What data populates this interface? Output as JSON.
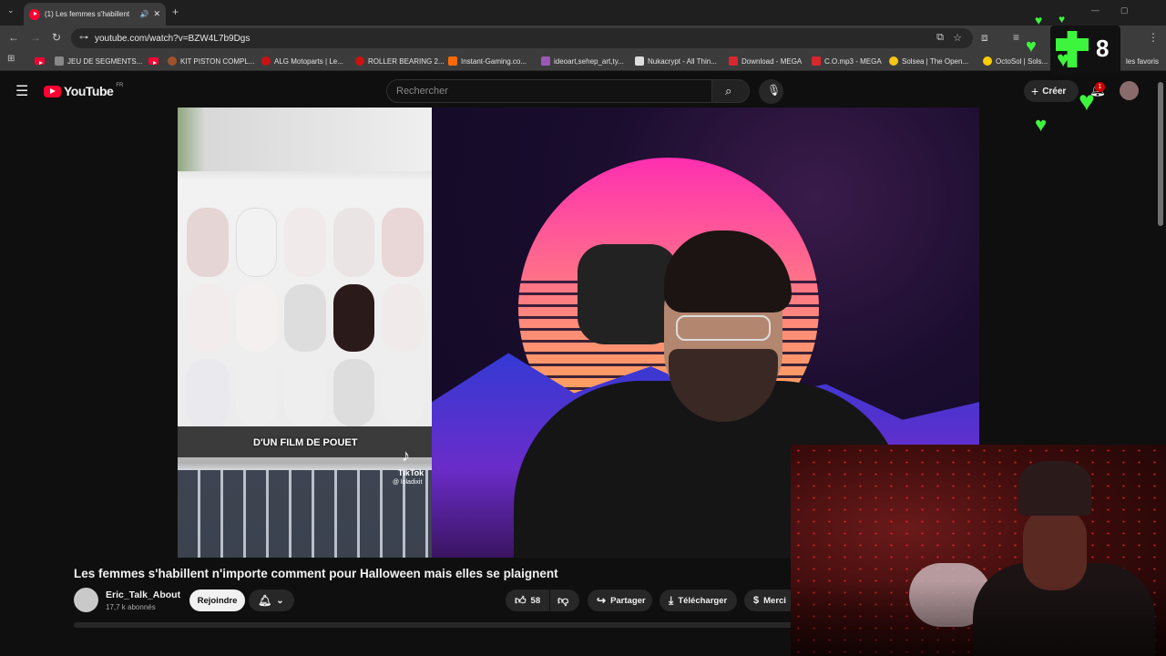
{
  "browser": {
    "tab_title": "(1) Les femmes s'habillent",
    "url": "youtube.com/watch?v=BZW4L7b9Dgs",
    "bookmarks": [
      {
        "label": "JEU DE SEGMENTS...",
        "color": "#888888"
      },
      {
        "label": "KIT PISTON COMPL...",
        "color": "#a0522d"
      },
      {
        "label": "ALG Motoparts | Le...",
        "color": "#cc1111"
      },
      {
        "label": "ROLLER BEARING 2...",
        "color": "#cc1111"
      },
      {
        "label": "Instant-Gaming.co...",
        "color": "#ff6a00"
      },
      {
        "label": "ideoart,sehep_art,ty...",
        "color": "#9b59b6"
      },
      {
        "label": "Nukacrypt - All Thin...",
        "color": "#dddddd"
      },
      {
        "label": "Download - MEGA",
        "color": "#d9272e"
      },
      {
        "label": "C.O.mp3 - MEGA",
        "color": "#d9272e"
      },
      {
        "label": "Solsea | The Open...",
        "color": "#f5c518"
      },
      {
        "label": "OctoSol | Sols...",
        "color": "#ffcc00"
      }
    ],
    "all_bookmarks": "les favoris"
  },
  "youtube": {
    "logo": "YouTube",
    "region": "FR",
    "search_placeholder": "Rechercher",
    "create_label": "Créer",
    "notif_count": "1"
  },
  "video": {
    "tiktok_caption": "D'UN FILM DE POUET",
    "tiktok_brand": "TikTok",
    "tiktok_user": "@ loladixit",
    "title": "Les femmes s'habillent n'importe comment pour Halloween mais elles se plaignent",
    "channel": "Eric_Talk_About",
    "subscribers": "17,7 k abonnés",
    "join_label": "Rejoindre",
    "likes": "58",
    "share_label": "Partager",
    "download_label": "Télécharger",
    "thanks_label": "Merci"
  },
  "overlay": {
    "counter": "8"
  }
}
